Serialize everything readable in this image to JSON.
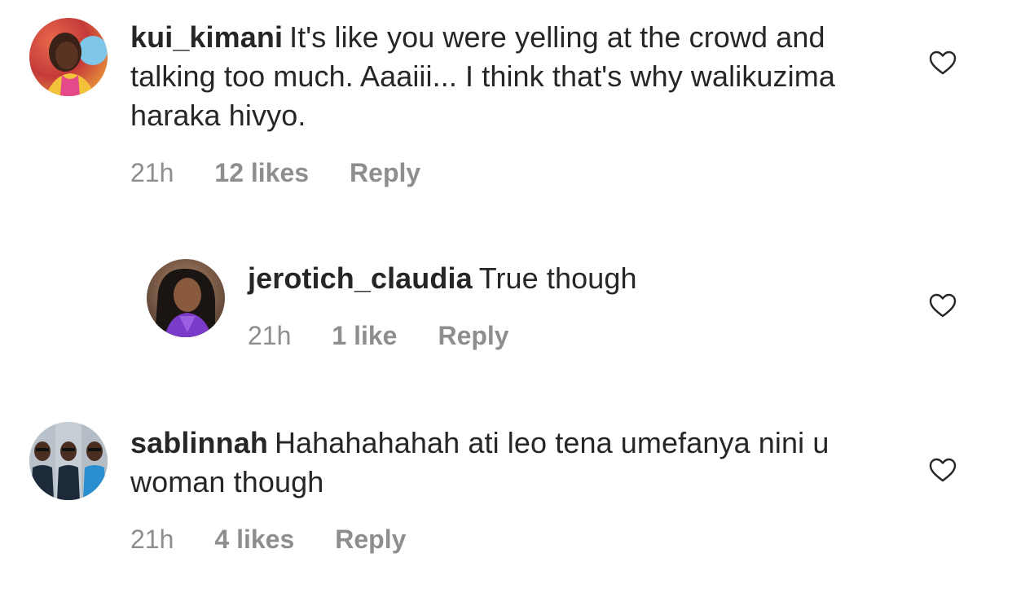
{
  "comments": [
    {
      "username": "kui_kimani",
      "text": "It's like you were yelling at the crowd and talking too much. Aaaiii... I think that's why walikuzima haraka hivyo.",
      "time": "21h",
      "likes": "12 likes",
      "reply_label": "Reply"
    },
    {
      "username": "jerotich_claudia",
      "text": "True though",
      "time": "21h",
      "likes": "1 like",
      "reply_label": "Reply"
    },
    {
      "username": "sablinnah",
      "text": "Hahahahahah ati leo tena umefanya nini u woman though",
      "time": "21h",
      "likes": "4 likes",
      "reply_label": "Reply"
    }
  ],
  "icons": {
    "like": "heart-outline-icon"
  },
  "colors": {
    "text": "#262626",
    "secondary": "#8e8e8e",
    "background": "#ffffff"
  }
}
